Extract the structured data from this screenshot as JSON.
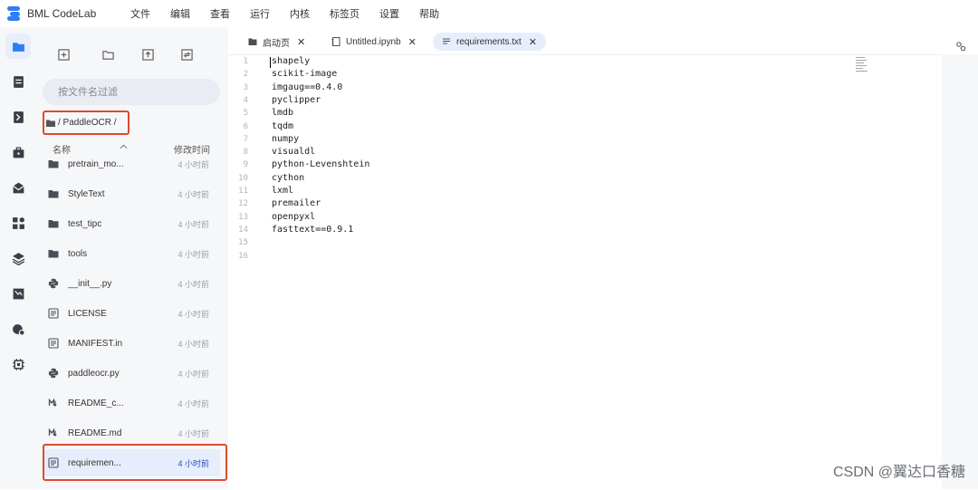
{
  "app": {
    "name": "BML CodeLab",
    "brand_color": "#2f7cf6"
  },
  "menu": [
    "文件",
    "编辑",
    "查看",
    "运行",
    "内核",
    "标签页",
    "设置",
    "帮助"
  ],
  "activity_bar": [
    {
      "icon": "folder-icon",
      "active": true
    },
    {
      "icon": "running-icon",
      "active": false
    },
    {
      "icon": "commands-icon",
      "active": false
    },
    {
      "icon": "toolbox-icon",
      "active": false
    },
    {
      "icon": "mail-icon",
      "active": false
    },
    {
      "icon": "extensions-icon",
      "active": false
    },
    {
      "icon": "layers-icon",
      "active": false
    },
    {
      "icon": "chart-icon",
      "active": false
    },
    {
      "icon": "deploy-icon",
      "active": false
    },
    {
      "icon": "chip-icon",
      "active": false
    }
  ],
  "file_browser": {
    "toolbar": [
      "new-launcher-icon",
      "new-folder-icon",
      "upload-icon",
      "refresh-icon"
    ],
    "filter_placeholder": "按文件名过滤",
    "breadcrumb": "/ PaddleOCR /",
    "columns": {
      "name": "名称",
      "modified": "修改时间"
    },
    "files": [
      {
        "name": "pretrain_mo...",
        "type": "folder",
        "modified": "4 小时前"
      },
      {
        "name": "StyleText",
        "type": "folder",
        "modified": "4 小时前"
      },
      {
        "name": "test_tipc",
        "type": "folder",
        "modified": "4 小时前"
      },
      {
        "name": "tools",
        "type": "folder",
        "modified": "4 小时前"
      },
      {
        "name": "__init__.py",
        "type": "python",
        "modified": "4 小时前"
      },
      {
        "name": "LICENSE",
        "type": "text",
        "modified": "4 小时前"
      },
      {
        "name": "MANIFEST.in",
        "type": "text",
        "modified": "4 小时前"
      },
      {
        "name": "paddleocr.py",
        "type": "python",
        "modified": "4 小时前"
      },
      {
        "name": "README_c...",
        "type": "markdown",
        "modified": "4 小时前"
      },
      {
        "name": "README.md",
        "type": "markdown",
        "modified": "4 小时前"
      },
      {
        "name": "requiremen...",
        "type": "text",
        "modified": "4 小时前",
        "selected": true
      }
    ]
  },
  "tabs": [
    {
      "label": "启动页",
      "icon": "launcher-icon",
      "active": false
    },
    {
      "label": "Untitled.ipynb",
      "icon": "notebook-icon",
      "active": false
    },
    {
      "label": "requirements.txt",
      "icon": "text-file-icon",
      "active": true
    }
  ],
  "editor": {
    "line_numbers": [
      "1",
      "2",
      "3",
      "4",
      "5",
      "6",
      "7",
      "8",
      "9",
      "10",
      "11",
      "12",
      "13",
      "14",
      "15",
      "16"
    ],
    "lines": [
      "shapely",
      "scikit-image",
      "imgaug==0.4.0",
      "pyclipper",
      "lmdb",
      "tqdm",
      "numpy",
      "visualdl",
      "python-Levenshtein",
      "cython",
      "lxml",
      "premailer",
      "openpyxl",
      "fasttext==0.9.1",
      "",
      ""
    ]
  },
  "watermark": "CSDN @翼达口香糖",
  "colors": {
    "highlight": "#e0492f",
    "selected_bg": "#e6eefc",
    "panel_bg": "#f6f7f9"
  }
}
